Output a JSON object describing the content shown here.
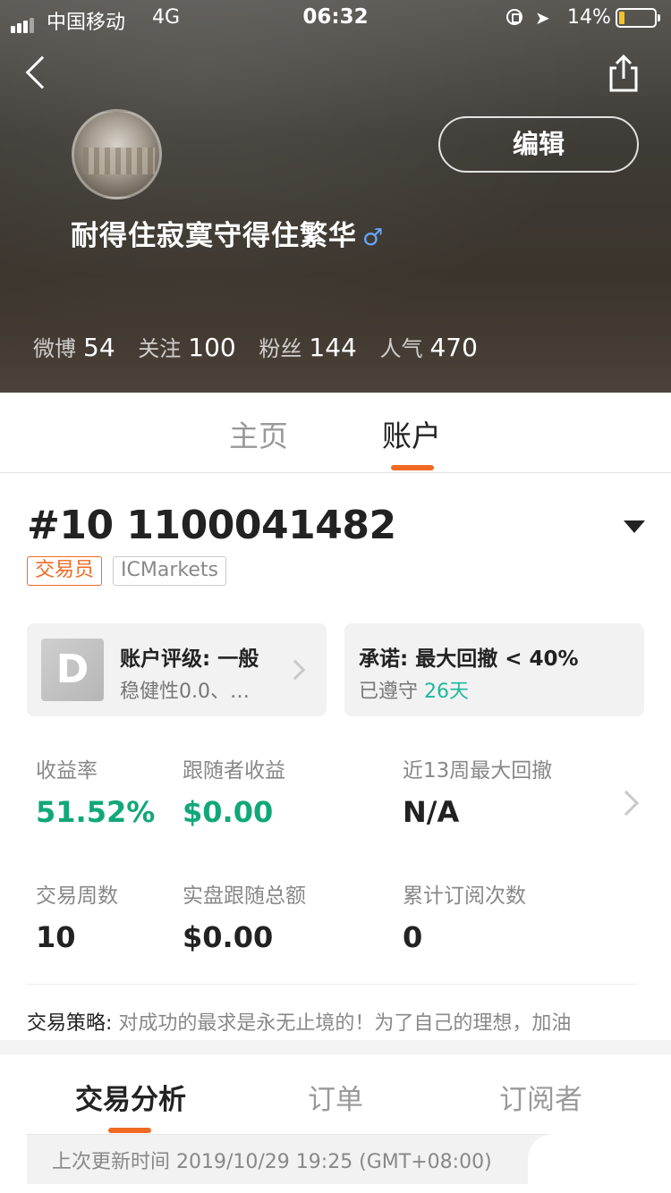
{
  "status_bar": {
    "carrier": "中国移动",
    "network": "4G",
    "time": "06:32",
    "battery": "14%"
  },
  "profile": {
    "edit_label": "编辑",
    "username": "耐得住寂寞守得住繁华",
    "gender_symbol": "♂",
    "stats": [
      {
        "label": "微博",
        "value": "54"
      },
      {
        "label": "关注",
        "value": "100"
      },
      {
        "label": "粉丝",
        "value": "144"
      },
      {
        "label": "人气",
        "value": "470"
      }
    ]
  },
  "tabs": [
    {
      "label": "主页",
      "active": false
    },
    {
      "label": "账户",
      "active": true
    }
  ],
  "account": {
    "id": "#10 1100041482",
    "role_badge": "交易员",
    "broker_badge": "ICMarkets",
    "grade_letter": "D",
    "rating_title": "账户评级: 一般",
    "rating_sub": "稳健性0.0、…",
    "promise_title": "承诺: 最大回撤 < 40%",
    "promise_sub_prefix": "已遵守",
    "promise_days": "26天"
  },
  "metrics": [
    {
      "label": "收益率",
      "value": "51.52%"
    },
    {
      "label": "跟随者收益",
      "value": "$0.00"
    },
    {
      "label": "近13周最大回撤",
      "value": "N/A"
    },
    {
      "label": "交易周数",
      "value": "10"
    },
    {
      "label": "实盘跟随总额",
      "value": "$0.00"
    },
    {
      "label": "累计订阅次数",
      "value": "0"
    }
  ],
  "strategy": {
    "label": "交易策略:",
    "text": "对成功的最求是永无止境的！为了自己的理想，加油"
  },
  "bottom_tabs": [
    {
      "label": "交易分析",
      "active": true
    },
    {
      "label": "订单",
      "active": false
    },
    {
      "label": "订阅者",
      "active": false
    }
  ],
  "updated": "上次更新时间 2019/10/29 19:25 (GMT+08:00)",
  "colors": {
    "accent": "#f06a23",
    "positive": "#12a77a",
    "teal": "#1fb89a",
    "male": "#6aa6ff"
  }
}
